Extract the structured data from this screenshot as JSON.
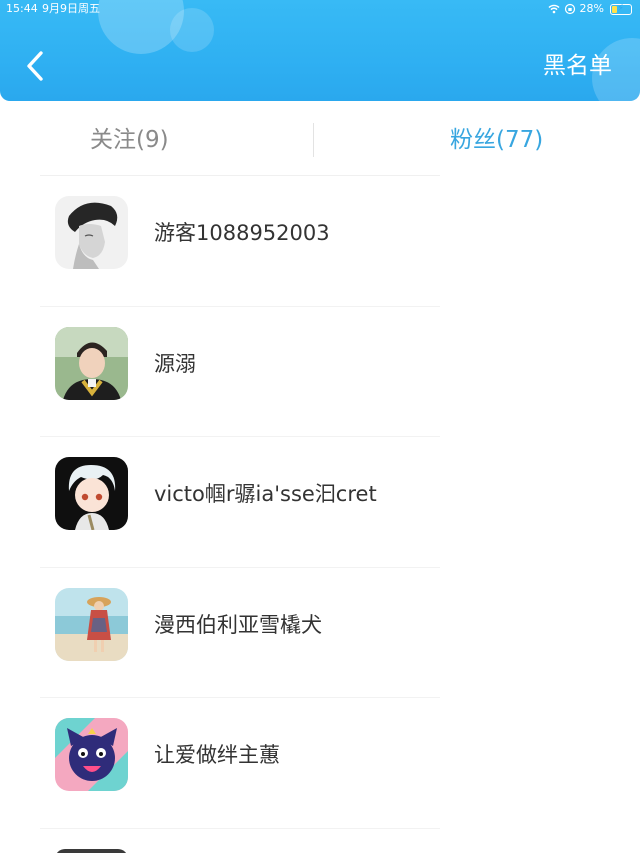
{
  "status_bar": {
    "time": "15:44",
    "date": "9月9日周五",
    "battery": "28%",
    "battery_level": 0.28
  },
  "header": {
    "back_icon": "chevron-left-icon",
    "right_button_label": "黑名单"
  },
  "tabs": [
    {
      "label": "关注",
      "count": "(9)",
      "active": false
    },
    {
      "label": "粉丝",
      "count": "(77)",
      "active": true
    }
  ],
  "users": [
    {
      "name": "游客1088952003",
      "avatar": "avatar-young-man-bw"
    },
    {
      "name": "源溺",
      "avatar": "avatar-boy-graduation"
    },
    {
      "name": "victo帼r骣ia'sse汩cret",
      "avatar": "avatar-anime-character"
    },
    {
      "name": "漫西伯利亚雪橇犬",
      "avatar": "avatar-girl-beach"
    },
    {
      "name": "让爱做绊主蕙",
      "avatar": "avatar-cartoon-cat"
    }
  ],
  "colors": {
    "header_blue": "#2fb0f2",
    "active_tab": "#38a6e0",
    "inactive_tab": "#8a8a8a",
    "name_text": "#333333"
  }
}
